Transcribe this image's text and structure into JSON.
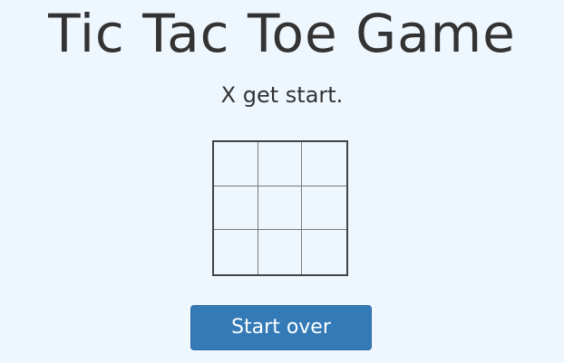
{
  "title": "Tic Tac Toe Game",
  "status": "X get start.",
  "board": {
    "cells": [
      "",
      "",
      "",
      "",
      "",
      "",
      "",
      "",
      ""
    ]
  },
  "restart_label": "Start over",
  "colors": {
    "background": "#eef6fe",
    "text": "#333333",
    "button": "#337ab7",
    "button_text": "#ffffff",
    "board_border": "#444444",
    "grid_line": "#7a7a7a"
  }
}
